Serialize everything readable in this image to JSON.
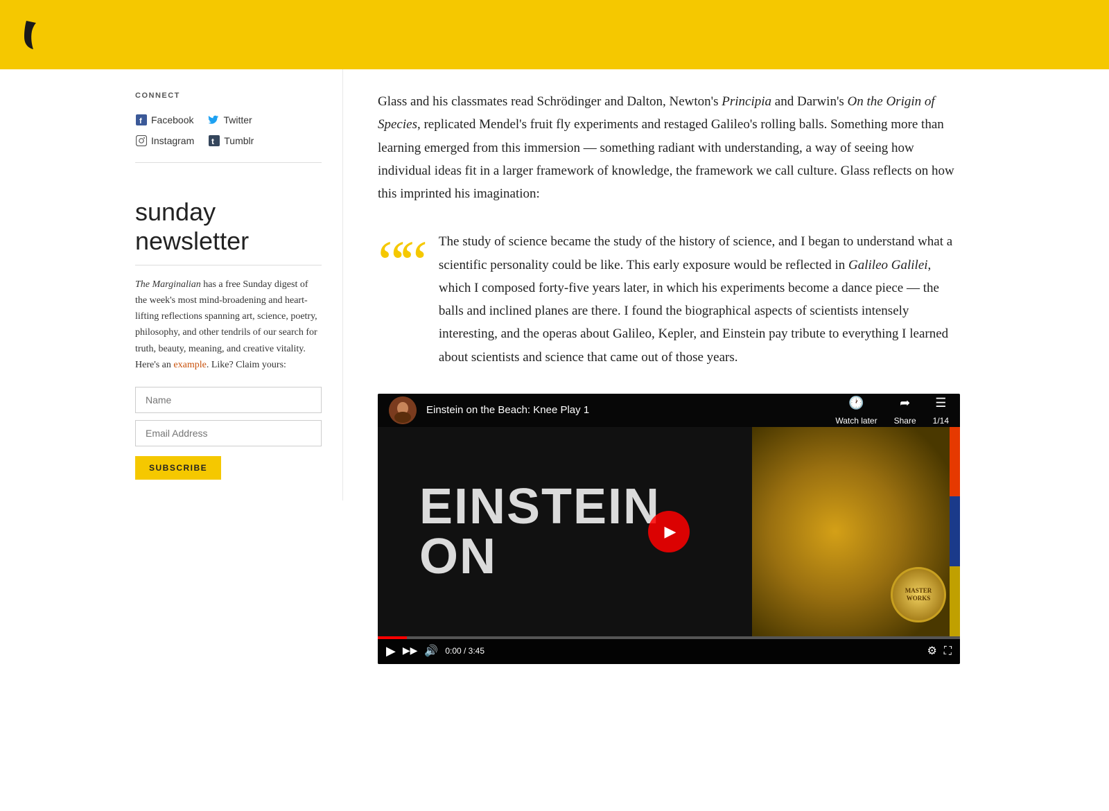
{
  "banner": {
    "background_color": "#f5c800"
  },
  "sidebar": {
    "connect": {
      "title": "CONNECT",
      "links": [
        {
          "id": "facebook",
          "label": "Facebook",
          "icon": "f"
        },
        {
          "id": "twitter",
          "label": "Twitter",
          "icon": "t"
        },
        {
          "id": "instagram",
          "label": "Instagram",
          "icon": "ig"
        },
        {
          "id": "tumblr",
          "label": "Tumblr",
          "icon": "tb"
        }
      ]
    },
    "newsletter": {
      "title": "sunday newsletter",
      "description_part1": "The Marginalian",
      "description_part2": " has a free Sunday digest of the week's most mind-broadening and heart-lifting reflections spanning art, science, poetry, philosophy, and other tendrils of our search for truth, beauty, meaning, and creative vitality. Here's an ",
      "example_link_text": "example",
      "description_part3": ". Like? Claim yours:",
      "name_placeholder": "Name",
      "email_placeholder": "Email Address",
      "subscribe_label": "SUBSCRIBE"
    }
  },
  "main": {
    "article_text": "Glass and his classmates read Schrödinger and Dalton, Newton's Principia and Darwin's On the Origin of Species, replicated Mendel's fruit fly experiments and restaged Galileo's rolling balls. Something more than learning emerged from this immersion — something radiant with understanding, a way of seeing how individual ideas fit in a larger framework of knowledge, the framework we call culture. Glass reflects on how this imprinted his imagination:",
    "article_text_italic1": "Principia",
    "article_text_italic2": "On the Origin of Species",
    "blockquote": {
      "text": "The study of science became the study of the history of science, and I began to understand what a scientific personality could be like. This early exposure would be reflected in Galileo Galilei, which I composed forty-five years later, in which his experiments become a dance piece — the balls and inclined planes are there. I found the biographical aspects of scientists intensely interesting, and the operas about Galileo, Kepler, and Einstein pay tribute to everything I learned about scientists and science that came out of those years.",
      "italic_phrase": "Galileo Galilei"
    },
    "video": {
      "title": "Einstein on the Beach: Knee Play 1",
      "watch_later": "Watch later",
      "share": "Share",
      "counter": "1/14",
      "einstein_text_line1": "EINSTEIN",
      "einstein_text_line2": "ON"
    }
  }
}
